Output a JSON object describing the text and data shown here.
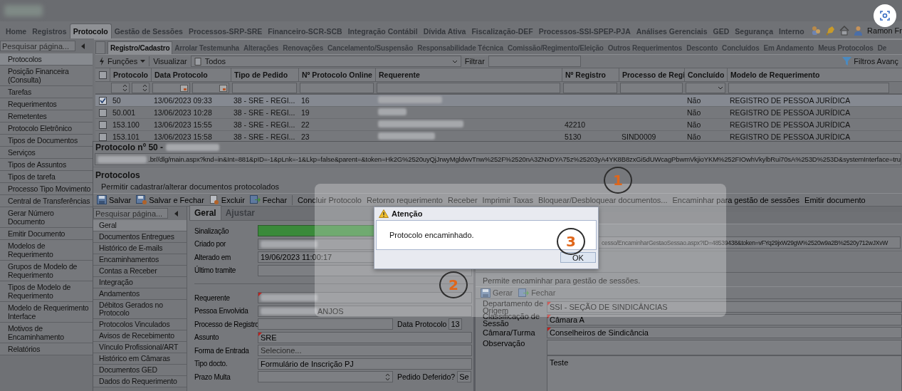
{
  "main_menu": [
    {
      "label": "Home",
      "selected": false
    },
    {
      "label": "Registros",
      "selected": false
    },
    {
      "label": "Protocolo",
      "selected": true
    },
    {
      "label": "Gestão de Sessões",
      "selected": false
    },
    {
      "label": "Processos-SRP-SRE",
      "selected": false
    },
    {
      "label": "Financeiro-SCR-SCB",
      "selected": false
    },
    {
      "label": "Integração Contábil",
      "selected": false
    },
    {
      "label": "Dívida Ativa",
      "selected": false
    },
    {
      "label": "Fiscalização-DEF",
      "selected": false
    },
    {
      "label": "Processos-SSI-SPEP-PJA",
      "selected": false
    },
    {
      "label": "Análises Gerenciais",
      "selected": false
    },
    {
      "label": "GED",
      "selected": false
    },
    {
      "label": "Segurança",
      "selected": false
    },
    {
      "label": "Interno",
      "selected": false
    }
  ],
  "user_name": "Ramon Fr",
  "sidebar": {
    "placeholder": "Pesquisar página...",
    "items": [
      {
        "label": "Protocolos",
        "selected": true
      },
      {
        "label": "Posição Financeira (Consulta)",
        "selected": false
      },
      {
        "label": "Tarefas",
        "selected": false
      },
      {
        "label": "Requerimentos",
        "selected": false
      },
      {
        "label": "Remetentes",
        "selected": false
      },
      {
        "label": "Protocolo Eletrônico",
        "selected": false
      },
      {
        "label": "Tipos de Documentos",
        "selected": false
      },
      {
        "label": "Serviços",
        "selected": false
      },
      {
        "label": "Tipos de Assuntos",
        "selected": false
      },
      {
        "label": "Tipos de tarefa",
        "selected": false
      },
      {
        "label": "Processo Tipo Movimento",
        "selected": false
      },
      {
        "label": "Central de Transferências",
        "selected": false
      },
      {
        "label": "Gerar Número Documento",
        "selected": false
      },
      {
        "label": "Emitir Documento",
        "selected": false
      },
      {
        "label": "Modelos de Requerimento",
        "selected": false
      },
      {
        "label": "Grupos de Modelo de Requerimento",
        "selected": false
      },
      {
        "label": "Tipos de Modelo de Requerimento",
        "selected": false
      },
      {
        "label": "Modelo de Requerimento Interface",
        "selected": false
      },
      {
        "label": "Motivos de Encaminhamento",
        "selected": false
      },
      {
        "label": "Relatórios",
        "selected": false
      }
    ]
  },
  "sub_tabs": [
    {
      "label": "Registro/Cadastro",
      "selected": true
    },
    {
      "label": "Arrolar Testemunha",
      "selected": false
    },
    {
      "label": "Alterações",
      "selected": false
    },
    {
      "label": "Renovações",
      "selected": false
    },
    {
      "label": "Cancelamento/Suspensão",
      "selected": false
    },
    {
      "label": "Responsabilidade Técnica",
      "selected": false
    },
    {
      "label": "Comissão/Regimento/Eleição",
      "selected": false
    },
    {
      "label": "Outros Requerimentos",
      "selected": false
    },
    {
      "label": "Desconto",
      "selected": false
    },
    {
      "label": "Concluídos",
      "selected": false
    },
    {
      "label": "Em Andamento",
      "selected": false
    },
    {
      "label": "Meus Protocolos",
      "selected": false
    },
    {
      "label": "De",
      "selected": false
    }
  ],
  "list_toolbar": {
    "functions": "Funções",
    "view_label": "Visualizar",
    "view_value": "Todos",
    "filter_label": "Filtrar",
    "advanced_filters": "Filtros Avanç"
  },
  "table": {
    "select_all": {
      "checked": false
    },
    "columns": [
      {
        "label": "Protocolo"
      },
      {
        "label": "Data Protocolo"
      },
      {
        "label": "Tipo de Pedido"
      },
      {
        "label": "Nº Protocolo Online"
      },
      {
        "label": "Requerente"
      },
      {
        "label": "Nº Registro"
      },
      {
        "label": "Processo de Regi"
      },
      {
        "label": "Concluído"
      },
      {
        "label": "Modelo de Requerimento"
      }
    ],
    "rows": [
      {
        "selected": true,
        "cells": [
          "50",
          "13/06/2023 09:33",
          "38 - SRE - REGI...",
          "16",
          null,
          null,
          null,
          "Não",
          "REGISTRO DE PESSOA JURÍDICA"
        ]
      },
      {
        "selected": false,
        "cells": [
          "50.001",
          "13/06/2023 10:28",
          "38 - SRE - REGI...",
          "19",
          null,
          null,
          null,
          "Não",
          "REGISTRO DE PESSOA JURÍDICA"
        ]
      },
      {
        "selected": false,
        "cells": [
          "153.100",
          "13/06/2023 15:55",
          "38 - SRE - REGI...",
          "22",
          null,
          "42210",
          null,
          "Não",
          "REGISTRO DE PESSOA JURÍDICA"
        ]
      },
      {
        "selected": false,
        "cells": [
          "153.101",
          "13/06/2023 15:58",
          "38 - SRE - REGI...",
          "23",
          null,
          "5130",
          "SIND0009",
          "Não",
          "REGISTRO DE PESSOA JURÍDICA"
        ]
      }
    ]
  },
  "protocol_window": {
    "title": "Protocolo nº 50 -",
    "url": ".br//dlg/main.aspx?knd=in&Int=881&pID=-1&pLnk=-1&Lkp=false&parent=&token=Hk2G%2520uyQjJrwyMgldwvTnw%252F%2520nA3ZNxDYA75z%25203yA4YK8B8zxGi5dUWcagPbwmVkjioYKM%252FIOwhVkylbRui70sA%253D%253D&systemInterface=tru",
    "heading": "Protocolos",
    "description": "Permitir cadastrar/alterar documentos protocolados",
    "toolbar": [
      {
        "label": "Salvar",
        "kind": "save"
      },
      {
        "label": "Salvar e Fechar",
        "kind": "save-close"
      },
      {
        "label": "Excluir",
        "kind": "delete"
      },
      {
        "label": "Fechar",
        "kind": "close"
      },
      {
        "label": "Concluir Protocolo",
        "kind": "text"
      },
      {
        "label": "Retorno requerimento",
        "kind": "text"
      },
      {
        "label": "Receber",
        "kind": "text"
      },
      {
        "label": "Imprimir Taxas",
        "kind": "text"
      },
      {
        "label": "Bloquear/Desbloquear documentos...",
        "kind": "text"
      },
      {
        "label": "Encaminhar para gestão de sessões",
        "kind": "text"
      },
      {
        "label": "Emitir documento",
        "kind": "text"
      }
    ],
    "nav_placeholder": "Pesquisar página...",
    "nav": [
      {
        "label": "Geral",
        "selected": true
      },
      {
        "label": "Documentos Entregues",
        "selected": false
      },
      {
        "label": "Histórico de E-mails",
        "selected": false
      },
      {
        "label": "Encaminhamentos",
        "selected": false
      },
      {
        "label": "Contas a Receber",
        "selected": false
      },
      {
        "label": "Integração",
        "selected": false
      },
      {
        "label": "Andamentos",
        "selected": false
      },
      {
        "label": "Débitos Gerados no Protocolo",
        "selected": false
      },
      {
        "label": "Protocolos Vinculados",
        "selected": false
      },
      {
        "label": "Avisos de Recebimento",
        "selected": false
      },
      {
        "label": "Vínculo Profissional/ART",
        "selected": false
      },
      {
        "label": "Histórico em Câmaras",
        "selected": false
      },
      {
        "label": "Documentos GED",
        "selected": false
      },
      {
        "label": "Dados do Requerimento",
        "selected": false
      }
    ],
    "tabs": [
      {
        "label": "Geral",
        "selected": true
      },
      {
        "label": "Ajustar",
        "selected": false
      }
    ],
    "form": [
      {
        "label": "Sinalização",
        "kind": "signal",
        "color": "#3a8a3a",
        "required": false
      },
      {
        "label": "Criado por",
        "kind": "redacted",
        "required": false
      },
      {
        "label": "Alterado em",
        "kind": "text",
        "value": "19/06/2023 11:00:17",
        "required": false
      },
      {
        "label": "Último tramite",
        "kind": "text",
        "required": false
      },
      {
        "kind": "separator"
      },
      {
        "label": "Requerente",
        "kind": "redacted",
        "required": true
      },
      {
        "label": "Pessoa Envolvida",
        "kind": "redacted",
        "value": "ANJOS",
        "required": false
      },
      {
        "label": "Processo de Registro",
        "kind": "text",
        "required": false,
        "extra": {
          "label": "Data Protocolo",
          "value": "13"
        }
      },
      {
        "label": "Assunto",
        "kind": "text",
        "value": "SRE",
        "required": true
      },
      {
        "label": "Forma de Entrada",
        "kind": "select",
        "placeholder": "Selecione...",
        "required": false
      },
      {
        "label": "Tipo docto.",
        "kind": "text",
        "value": "Formulário de Inscrição PJ",
        "required": false
      },
      {
        "label": "Prazo Multa",
        "kind": "spinner",
        "required": false,
        "extra": {
          "label": "Pedido Deferido?",
          "value": "Se"
        }
      }
    ]
  },
  "forward_window": {
    "url": "cesso/EncaminharGestaoSessao.aspx?ID=48539438&token=vFYq29jxW29gW%2520w9a2B%2520y712wJXvW",
    "description": "Permite encaminhar para gestão de sessões.",
    "toolbar": [
      {
        "label": "Gerar",
        "kind": "save"
      },
      {
        "label": "Fechar",
        "kind": "close"
      }
    ],
    "form": [
      {
        "label": "Departamento de Origem",
        "kind": "text",
        "value": "SSI - SEÇÃO DE SINDICÂNCIAS",
        "required": true
      },
      {
        "label": "Classificação de Sessão",
        "kind": "text",
        "value": "Câmara A",
        "required": true
      },
      {
        "label": "Câmara/Turma",
        "kind": "text",
        "value": "Conselheiros de Sindicância",
        "required": true
      },
      {
        "label": "Observação",
        "kind": "textarea",
        "value": "Teste",
        "required": false
      }
    ]
  },
  "alert": {
    "title": "Atenção",
    "message": "Protocolo encaminhado.",
    "button": "OK"
  },
  "annotations": [
    {
      "label": "1"
    },
    {
      "label": "2"
    },
    {
      "label": "3"
    }
  ]
}
